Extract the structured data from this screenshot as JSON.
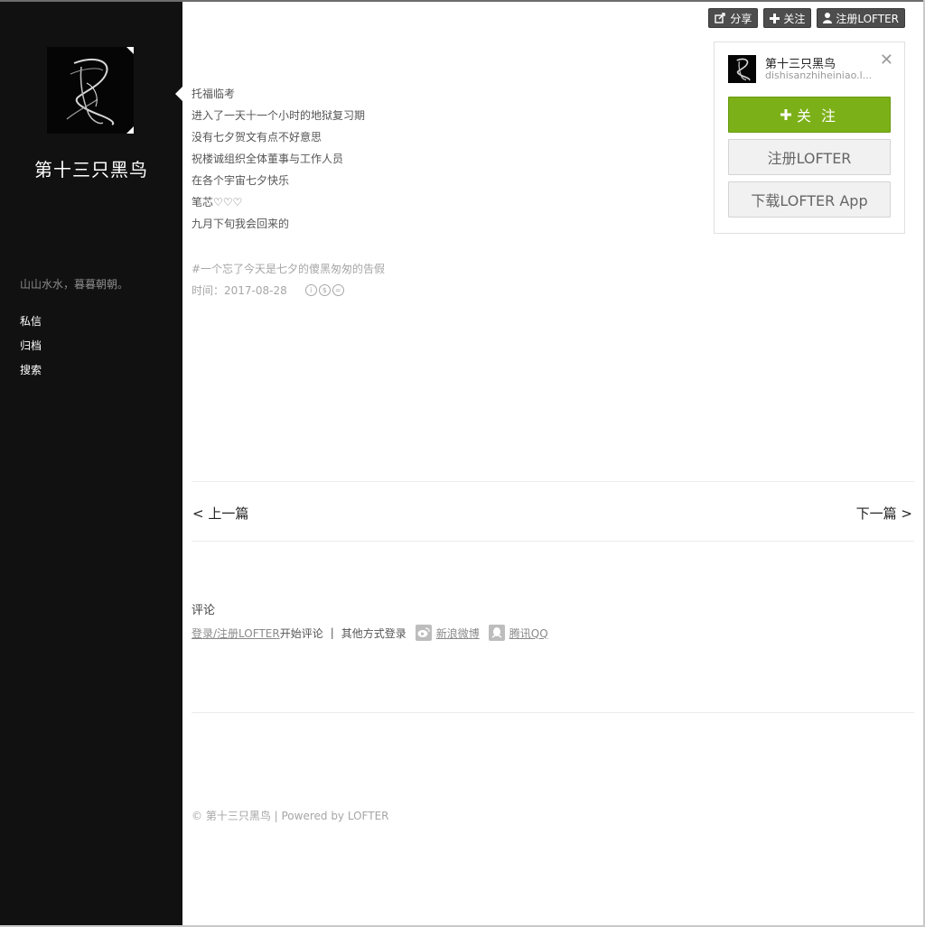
{
  "sidebar": {
    "blog_title": "第十三只黑鸟",
    "description": "山山水水，暮暮朝朝。",
    "nav": [
      {
        "label": "私信"
      },
      {
        "label": "归档"
      },
      {
        "label": "搜索"
      }
    ]
  },
  "top_bar": {
    "share_label": "分享",
    "follow_label": "关注",
    "register_label": "注册LOFTER"
  },
  "follow_card": {
    "name": "第十三只黑鸟",
    "domain": "dishisanzhiheiniao.l...",
    "close_symbol": "✕",
    "follow_label": "关 注",
    "register_label": "注册LOFTER",
    "download_label": "下载LOFTER App"
  },
  "post": {
    "lines": [
      "托福临考",
      "进入了一天十一个小时的地狱复习期",
      "没有七夕贺文有点不好意思",
      "祝楼诚组织全体董事与工作人员",
      "在各个宇宙七夕快乐",
      "笔芯♡♡♡",
      "九月下旬我会回来的"
    ],
    "tag": "#一个忘了今天是七夕的傻黑匆匆的告假",
    "time_label": "时间：2017-08-28"
  },
  "pagination": {
    "prev": "< 上一篇",
    "next": "下一篇 >"
  },
  "comments": {
    "title": "评论",
    "login_link": "登录/注册LOFTER",
    "start_text": " 开始评论",
    "separator": "|",
    "other_login": "其他方式登录",
    "weibo": "新浪微博",
    "qq": "腾讯QQ"
  },
  "footer": {
    "text": "© 第十三只黑鸟 | Powered by LOFTER"
  },
  "colors": {
    "sidebar_bg": "#111111",
    "follow_green": "#7cb018",
    "top_button_bg": "#4d4d4d"
  }
}
